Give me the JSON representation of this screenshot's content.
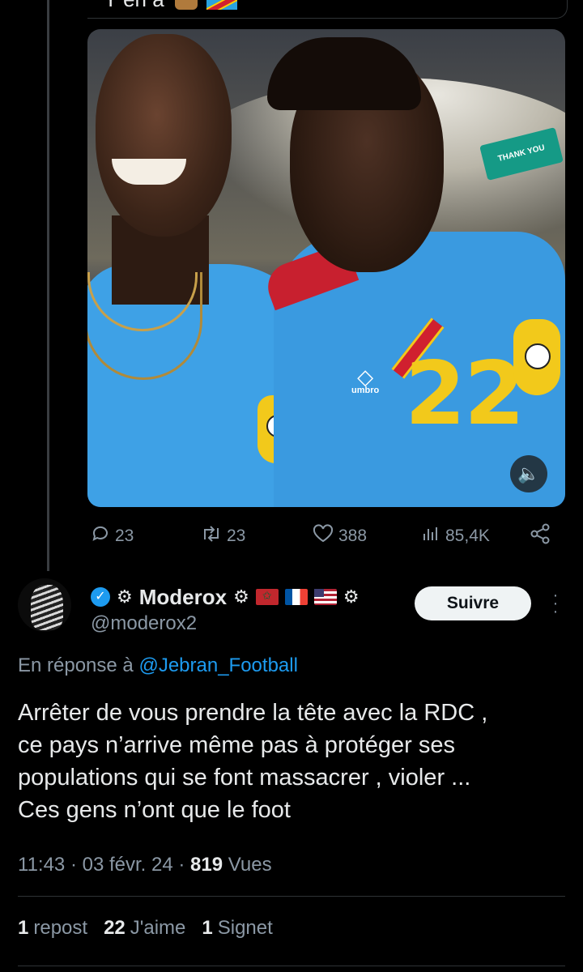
{
  "quoted_tweet": {
    "caption": "Y en a",
    "media": {
      "banner_text": "THANK YOU",
      "jersey_number": "22",
      "kit_brand": "umbro"
    },
    "actions": {
      "replies": "23",
      "reposts": "23",
      "likes": "388",
      "views": "85,4K"
    }
  },
  "reply": {
    "display_name": "Moderox",
    "handle": "@moderox2",
    "follow_label": "Suivre",
    "reply_prefix": "En réponse à",
    "reply_mention": "@Jebran_Football",
    "text_lines": [
      "Arrêter de vous prendre la tête avec la RDC ,",
      "ce pays n’arrive même pas à protéger ses",
      "populations qui se font massacrer , violer ...",
      "Ces gens n’ont que le foot"
    ],
    "time": "11:43",
    "date": "03 févr. 24",
    "views_count": "819",
    "views_label": "Vues",
    "stats": {
      "reposts_count": "1",
      "reposts_label": "repost",
      "likes_count": "22",
      "likes_label": "J'aime",
      "bookmarks_count": "1",
      "bookmarks_label": "Signet"
    }
  },
  "colors": {
    "background": "#000000",
    "text": "#e7e9ea",
    "secondary": "#8b98a5",
    "accent": "#1d9bf0"
  }
}
